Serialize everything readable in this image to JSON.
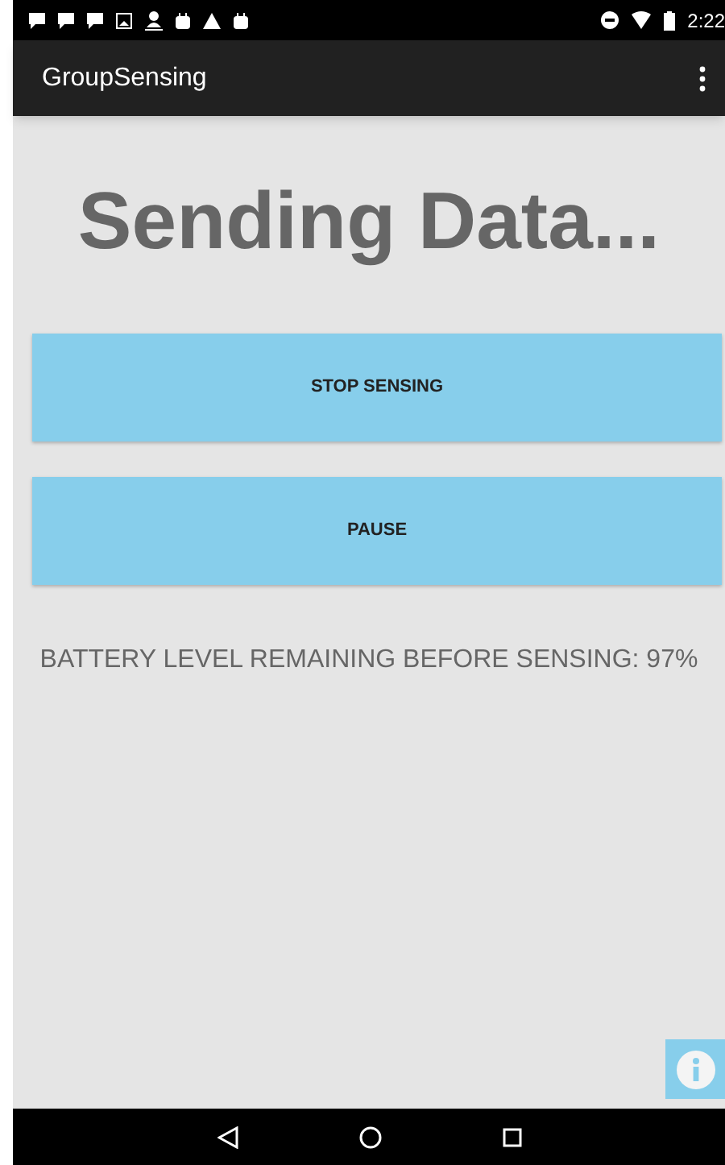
{
  "status_bar": {
    "time": "2:22"
  },
  "app_bar": {
    "title": "GroupSensing"
  },
  "heading": "Sending Data...",
  "buttons": [
    {
      "label": "STOP SENSING"
    },
    {
      "label": "PAUSE"
    }
  ],
  "battery_text": "BATTERY LEVEL REMAINING BEFORE SENSING: 97%"
}
